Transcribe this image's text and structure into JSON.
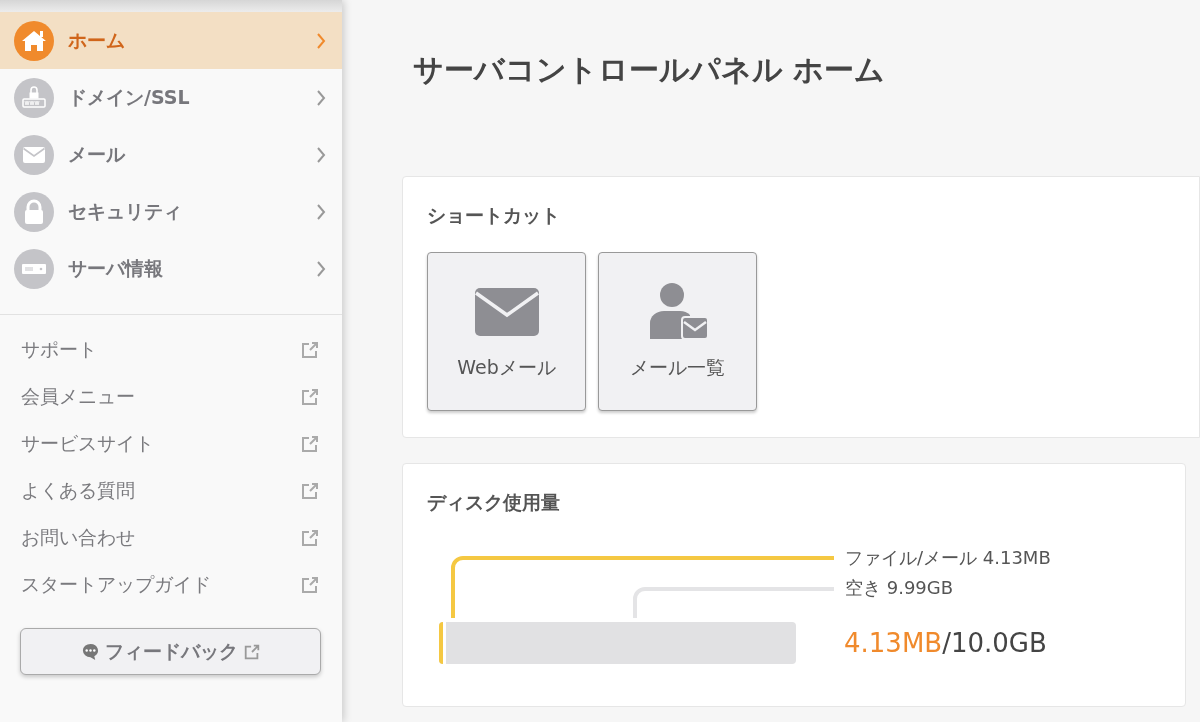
{
  "sidebar": {
    "nav": [
      {
        "label": "ホーム",
        "kind": "home",
        "selected": true
      },
      {
        "label": "ドメイン/SSL",
        "kind": "domain",
        "selected": false
      },
      {
        "label": "メール",
        "kind": "mail",
        "selected": false
      },
      {
        "label": "セキュリティ",
        "kind": "security",
        "selected": false
      },
      {
        "label": "サーバ情報",
        "kind": "server",
        "selected": false
      }
    ],
    "links": [
      "サポート",
      "会員メニュー",
      "サービスサイト",
      "よくある質問",
      "お問い合わせ",
      "スタートアップガイド"
    ],
    "feedback_button": "フィードバック"
  },
  "page_title": "サーバコントロールパネル ホーム",
  "shortcuts": {
    "title": "ショートカット",
    "items": [
      {
        "label": "Webメール",
        "kind": "webmail"
      },
      {
        "label": "メール一覧",
        "kind": "maillist"
      }
    ]
  },
  "disk": {
    "title": "ディスク使用量",
    "used_label": "ファイル/メール 4.13MB",
    "free_label": "空き 9.99GB",
    "level": 0.0004,
    "used": "4.13MB",
    "total": "/10.0GB"
  }
}
